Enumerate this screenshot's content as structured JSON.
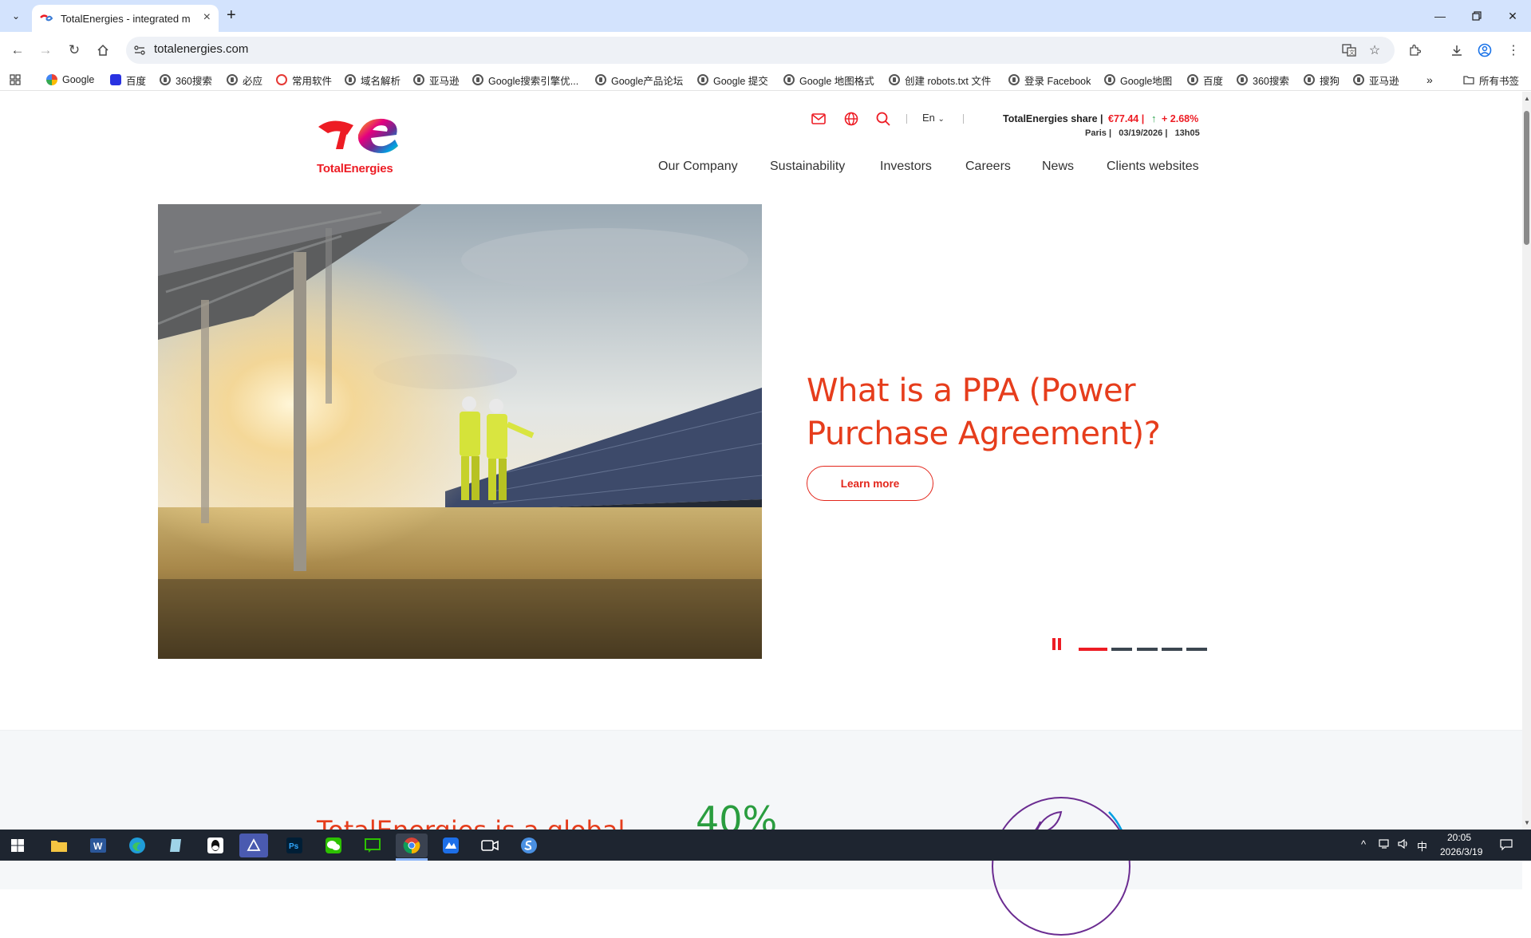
{
  "browser": {
    "tab_title": "TotalEnergies - integrated m",
    "url": "totalenergies.com",
    "bookmarks": [
      "Google",
      "百度",
      "360搜索",
      "必应",
      "常用软件",
      "域名解析",
      "亚马逊",
      "Google搜索引擎优...",
      "Google产品论坛",
      "Google 提交",
      "Google 地图格式",
      "创建 robots.txt 文件",
      "登录 Facebook",
      "Google地图",
      "百度",
      "360搜索",
      "搜狗",
      "亚马逊"
    ],
    "all_bookmarks_label": "所有书签"
  },
  "site": {
    "logo_text": "TotalEnergies",
    "language": "En",
    "share": {
      "label": "TotalEnergies share |",
      "price": "€77.44 |",
      "change": "+ 2.68%",
      "row2": "Paris |   03/19/2026 |   13h05"
    },
    "nav": [
      "Our Company",
      "Sustainability",
      "Investors",
      "Careers",
      "News",
      "Clients websites"
    ],
    "hero": {
      "title": "What is a PPA (Power Purchase Agreement)?",
      "button": "Learn more"
    },
    "stats": {
      "heading": "TotalEnergies is a global",
      "number": "40%"
    }
  },
  "taskbar": {
    "time": "20:05",
    "date": "2026/3/19",
    "ime": "中"
  },
  "colors": {
    "brand_red": "#ed1c24",
    "hero_title": "#e63d1c",
    "share_up": "#2da44e",
    "stat_green": "#2a9d3f"
  }
}
